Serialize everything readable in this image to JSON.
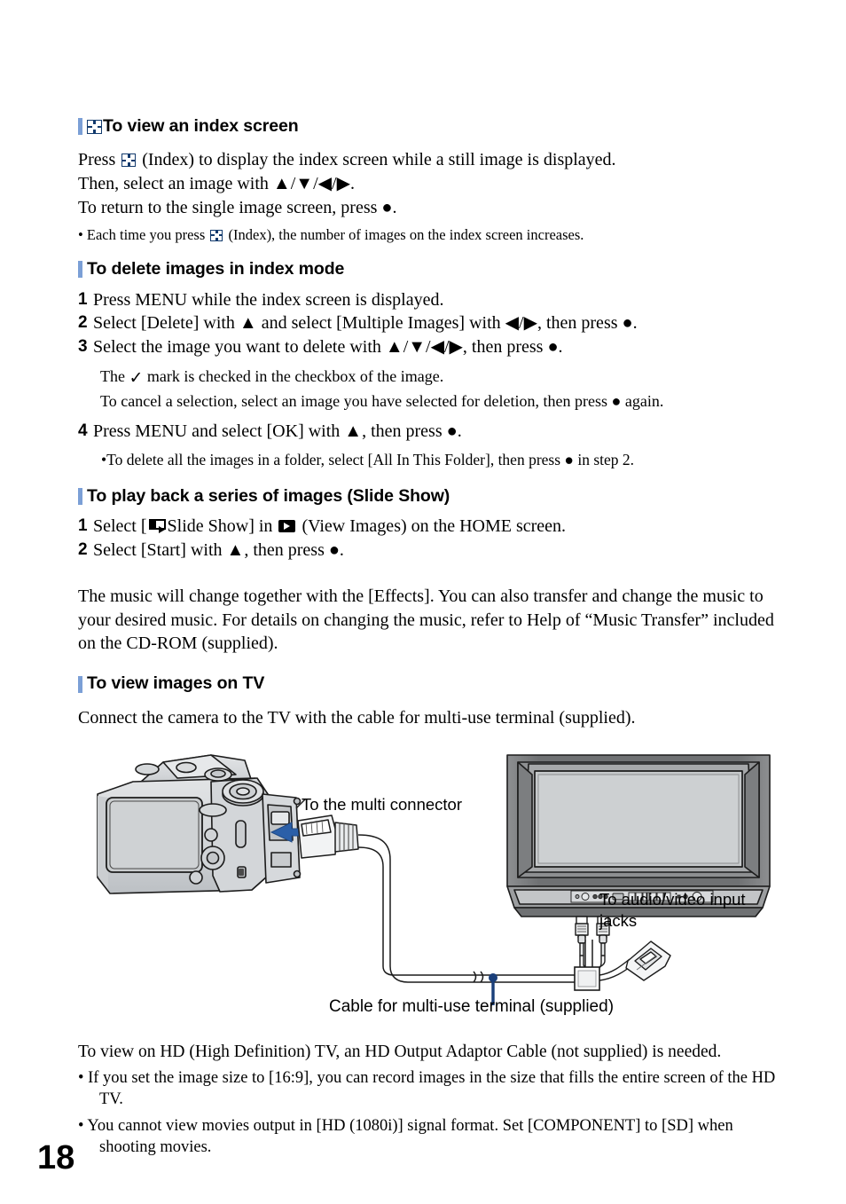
{
  "page": {
    "number": "18"
  },
  "sections": {
    "index_screen": {
      "heading": "To view an index screen",
      "icon": "index-checkerboard-icon",
      "line1_a": "Press",
      "line1_b": "(Index) to display the index screen while a still image is displayed.",
      "line2": "Then, select an image with ▲/▼/◀/▶.",
      "line3": "To return to the single image screen, press ●.",
      "note_a": "• Each time you press",
      "note_b": "(Index), the number of images on the index screen increases."
    },
    "delete_index": {
      "heading": "To delete images in index mode",
      "steps": [
        {
          "num": "1",
          "text": "Press MENU while the index screen is displayed."
        },
        {
          "num": "2",
          "text": "Select [Delete] with ▲ and select [Multiple Images] with ◀/▶, then press ●."
        },
        {
          "num": "3",
          "text": "Select the image you want to delete with ▲/▼/◀/▶, then press ●."
        }
      ],
      "note1_a": "The",
      "note1_b": "mark is checked in the checkbox of the image.",
      "note2": "To cancel a selection, select an image you have selected for deletion, then press ● again.",
      "step4": {
        "num": "4",
        "text": "Press MENU and select [OK] with ▲, then press ●."
      },
      "note3": "•To delete all the images in a folder, select [All In This Folder], then press ● in step 2."
    },
    "slide_show": {
      "heading": "To play back a series of images (Slide Show)",
      "step1_num": "1",
      "step1_a": "Select [",
      "step1_b": "Slide Show] in",
      "step1_c": "(View Images) on the HOME screen.",
      "step2_num": "2",
      "step2": "Select [Start] with ▲, then press ●.",
      "paragraph": "The music will change together with the [Effects]. You can also transfer and change the music to your desired music. For details on changing the music, refer to Help of “Music Transfer” included on the CD-ROM (supplied)."
    },
    "view_on_tv": {
      "heading": "To view images on TV",
      "intro": "Connect the camera to the TV with the cable for multi-use terminal (supplied).",
      "figure": {
        "label_multi_connector": "To the multi connector",
        "label_av_jacks_line1": "To audio/video input",
        "label_av_jacks_line2": "jacks",
        "caption_cable": "Cable for multi-use terminal (supplied)",
        "camera_alt": "camera-rear-illustration",
        "tv_alt": "television-illustration"
      },
      "hd_note": "To view on HD (High Definition) TV, an HD Output Adaptor Cable (not supplied) is needed.",
      "bullets": [
        {
          "main": "• If you set the image size to [16:9], you can record images in the size that fills the entire screen of the HD",
          "cont": "TV."
        },
        {
          "main": "• You cannot view movies output in [HD (1080i)] signal format. Set [COMPONENT] to [SD] when",
          "cont": "shooting movies."
        }
      ]
    }
  },
  "colors": {
    "heading_bar": "#7b9fd6",
    "index_icon": "#123a6d",
    "arrow_blue": "#2b5fa8",
    "leader_blue": "#1a3f7a",
    "body_gray": "#d4d6d8",
    "tv_bezel": "#6e6e6e",
    "screen_gray": "#c9cbcd"
  }
}
